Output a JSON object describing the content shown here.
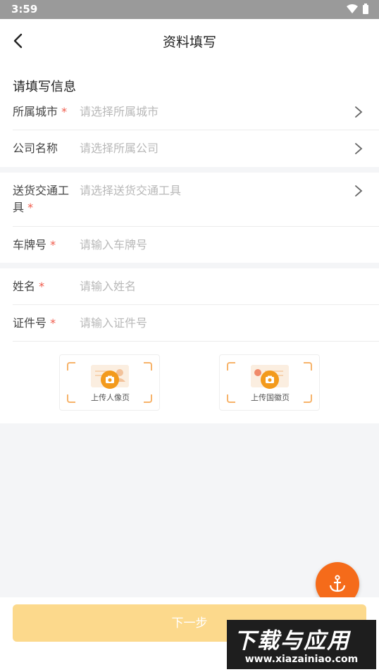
{
  "status_bar": {
    "time": "3:59"
  },
  "header": {
    "title": "资料填写"
  },
  "section": {
    "title": "请填写信息"
  },
  "form": {
    "city": {
      "label": "所属城市",
      "required": "*",
      "placeholder": "请选择所属城市"
    },
    "company": {
      "label": "公司名称",
      "placeholder": "请选择所属公司"
    },
    "vehicle": {
      "label": "送货交通工具",
      "required": "*",
      "placeholder": "请选择送货交通工具"
    },
    "plate": {
      "label": "车牌号",
      "required": "*",
      "placeholder": "请输入车牌号"
    },
    "name": {
      "label": "姓名",
      "required": "*",
      "placeholder": "请输入姓名"
    },
    "id_number": {
      "label": "证件号",
      "required": "*",
      "placeholder": "请输入证件号"
    }
  },
  "uploads": {
    "portrait": {
      "label": "上传人像页"
    },
    "emblem": {
      "label": "上传国徽页"
    }
  },
  "footer": {
    "next_label": "下一步"
  },
  "watermark": {
    "top": "下载与应用",
    "bottom": "www.xiazainiao.com"
  },
  "colors": {
    "accent": "#f39a1c",
    "fab": "#f56b1a",
    "required": "#f05a4a",
    "button": "#fcd98c"
  }
}
